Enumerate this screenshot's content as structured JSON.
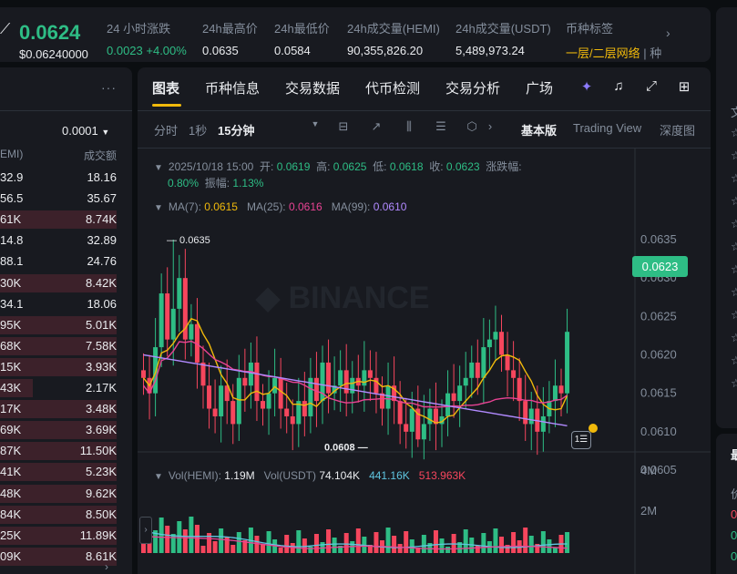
{
  "ticker": {
    "last_price": "0.0624",
    "usd_price": "$0.06240000",
    "stats": [
      {
        "label": "24 小时涨跌",
        "value": "0.0023 +4.00%",
        "style": "green"
      },
      {
        "label": "24h最高价",
        "value": "0.0635",
        "style": ""
      },
      {
        "label": "24h最低价",
        "value": "0.0584",
        "style": ""
      },
      {
        "label": "24h成交量(HEMI)",
        "value": "90,355,826.20",
        "style": ""
      },
      {
        "label": "24h成交量(USDT)",
        "value": "5,489,973.24",
        "style": ""
      }
    ],
    "tag_label": "币种标签",
    "tag_value": "一层/二层网络",
    "tag_more": " | 种"
  },
  "orderbook": {
    "tick_size": "0.0001",
    "header_left": "EMI)",
    "header_right": "成交额",
    "rows": [
      {
        "price": "32.9",
        "amount": "18.16",
        "fill": 0
      },
      {
        "price": "56.5",
        "amount": "35.67",
        "fill": 0
      },
      {
        "price": "61K",
        "amount": "8.74K",
        "fill": 1.0
      },
      {
        "price": "14.8",
        "amount": "32.89",
        "fill": 0
      },
      {
        "price": "88.1",
        "amount": "24.76",
        "fill": 0
      },
      {
        "price": "30K",
        "amount": "8.42K",
        "fill": 1.0
      },
      {
        "price": "34.1",
        "amount": "18.06",
        "fill": 0
      },
      {
        "price": "95K",
        "amount": "5.01K",
        "fill": 1.0
      },
      {
        "price": "68K",
        "amount": "7.58K",
        "fill": 1.0
      },
      {
        "price": "15K",
        "amount": "3.93K",
        "fill": 1.0
      },
      {
        "price": "43K",
        "amount": "2.17K",
        "fill": 0.28
      },
      {
        "price": "17K",
        "amount": "3.48K",
        "fill": 1.0
      },
      {
        "price": "69K",
        "amount": "3.69K",
        "fill": 1.0
      },
      {
        "price": "87K",
        "amount": "11.50K",
        "fill": 1.0
      },
      {
        "price": "41K",
        "amount": "5.23K",
        "fill": 1.0
      },
      {
        "price": "48K",
        "amount": "9.62K",
        "fill": 1.0
      },
      {
        "price": "84K",
        "amount": "8.50K",
        "fill": 1.0
      },
      {
        "price": "25K",
        "amount": "11.89K",
        "fill": 1.0
      },
      {
        "price": "09K",
        "amount": "8.61K",
        "fill": 1.0
      }
    ]
  },
  "tabs": [
    "图表",
    "币种信息",
    "交易数据",
    "代币检测",
    "交易分析",
    "广场"
  ],
  "toolbar": {
    "time": "分时",
    "sec": "1秒",
    "interval": "15分钟",
    "basic": "基本版",
    "tradingview": "Trading View",
    "depth": "深度图"
  },
  "legend": {
    "date": "2025/10/18 15:00",
    "open_label": "开:",
    "open": "0.0619",
    "high_label": "高:",
    "high": "0.0625",
    "low_label": "低:",
    "low": "0.0618",
    "close_label": "收:",
    "close": "0.0623",
    "chg_label": "涨跌幅:",
    "chg": "0.80%",
    "amp_label": "振幅:",
    "amp": "1.13%",
    "ma7_label": "MA(7):",
    "ma7": "0.0615",
    "ma25_label": "MA(25):",
    "ma25": "0.0616",
    "ma99_label": "MA(99):",
    "ma99": "0.0610",
    "vol_label": "Vol(HEMI):",
    "vol": "1.19M",
    "volusdt_label": "Vol(USDT)",
    "volusdt": "74.104K",
    "vol_ma1": "441.16K",
    "vol_ma2": "513.963K"
  },
  "price_axis": [
    "0.0635",
    "0.0630",
    "0.0625",
    "0.0620",
    "0.0615",
    "0.0610",
    "0.0605"
  ],
  "volume_axis": [
    "4M",
    "2M"
  ],
  "current_price_tag": "0.0623",
  "annotations": {
    "high": "0.0635",
    "low": "0.0608"
  },
  "right_panel": [
    "文",
    "☆",
    "☆",
    "☆",
    "☆",
    "☆",
    "☆",
    "☆",
    "☆",
    "☆",
    "☆",
    "☆",
    "☆"
  ],
  "right_panel_bottom": [
    "最",
    "价",
    "0",
    "0",
    "0"
  ],
  "colors": {
    "up": "#2ebd85",
    "down": "#f6465d",
    "accent": "#f0b90b",
    "bg": "#181a20"
  }
}
